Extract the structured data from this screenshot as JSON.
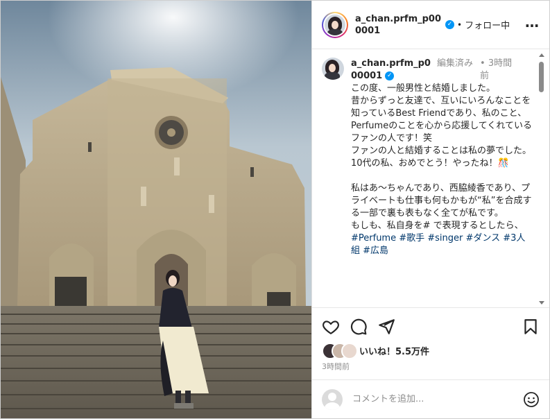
{
  "post": {
    "username": "a_chan.prfm_p000001",
    "follow_status": "フォロー中",
    "more_icon": "more-horizontal-icon",
    "verified_icon": "verified-badge-icon"
  },
  "caption": {
    "username": "a_chan.prfm_p000001",
    "edited": "編集済み",
    "time": "3時間前",
    "text": "この度、一般男性と結婚しました。\n昔からずっと友達で、互いにいろんなことを知っているBest Friendであり、私のこと、Perfumeのことを心から応援してくれている\nファンの人です！笑\nファンの人と結婚することは私の夢でした。\n10代の私、おめでとう！やったね！🎊\n\n私はあ〜ちゃんであり、西脇綾香であり、プライベートも仕事も何もかもが“私”を合成する一部で裏も表もなく全てが私です。\nもしも、私自身を# で表現するとしたら、",
    "hashtags": "#Perfume #歌手 #singer #ダンス #3人組 #広島"
  },
  "actions": {
    "likes_label": "いいね！5.5万件",
    "timestamp": "3時間前",
    "icons": [
      "heart-icon",
      "comment-icon",
      "share-icon",
      "bookmark-icon"
    ]
  },
  "comment_input": {
    "placeholder": "コメントを追加...",
    "emoji_icon": "emoji-icon"
  },
  "colors": {
    "accent_blue": "#0095f6",
    "hashtag_blue": "#00376b",
    "muted_text": "#8e8e8e"
  }
}
